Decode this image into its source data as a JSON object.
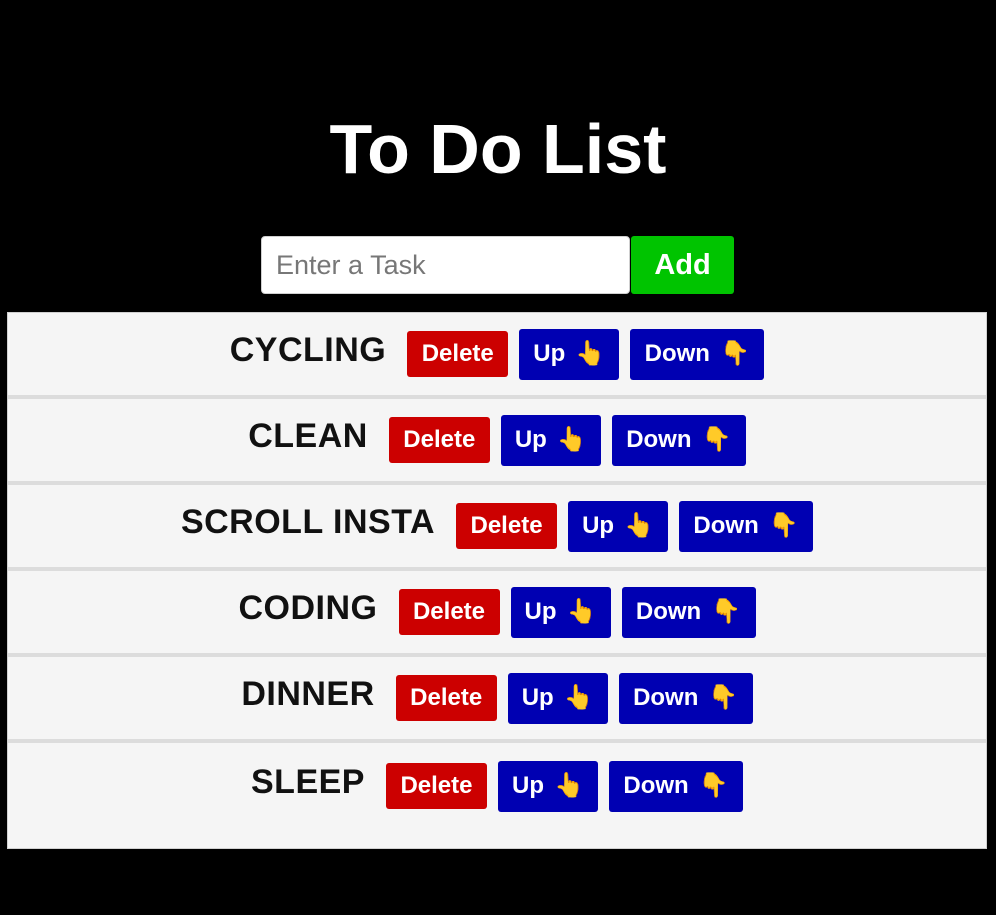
{
  "page": {
    "title": "To Do List"
  },
  "form": {
    "input_placeholder": "Enter a Task",
    "input_value": "",
    "add_label": "Add"
  },
  "tasks": [
    {
      "text": "CYCLING",
      "delete_label": "Delete",
      "up_label": "Up",
      "down_label": "Down"
    },
    {
      "text": "CLEAN",
      "delete_label": "Delete",
      "up_label": "Up",
      "down_label": "Down"
    },
    {
      "text": "SCROLL INSTA",
      "delete_label": "Delete",
      "up_label": "Up",
      "down_label": "Down"
    },
    {
      "text": "CODING",
      "delete_label": "Delete",
      "up_label": "Up",
      "down_label": "Down"
    },
    {
      "text": "DINNER",
      "delete_label": "Delete",
      "up_label": "Up",
      "down_label": "Down"
    },
    {
      "text": "SLEEP",
      "delete_label": "Delete",
      "up_label": "Up",
      "down_label": "Down"
    }
  ],
  "icons": {
    "up": "pointing-up-hand-icon",
    "down": "pointing-down-hand-icon"
  },
  "colors": {
    "background": "#000000",
    "add_button": "#00c400",
    "delete_button": "#cc0000",
    "move_button": "#0000b2",
    "list_background": "#f5f5f5"
  }
}
